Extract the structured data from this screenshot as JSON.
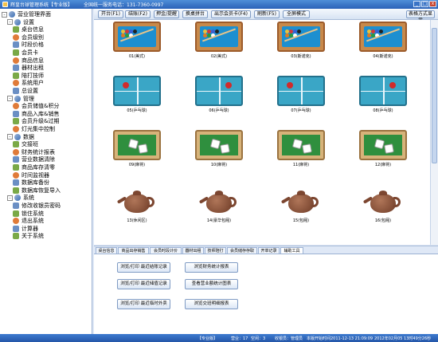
{
  "window": {
    "title": "辉皇台球管理系统【专业版】",
    "phone": "全国统一服务电话：131-7360-0997",
    "controls": [
      "_",
      "□",
      "x"
    ]
  },
  "tree": {
    "rows": [
      {
        "label": "营业管理界面",
        "level": 0,
        "exp": "-",
        "icon": "computer-icon"
      },
      {
        "label": "设置",
        "level": 1,
        "exp": "-",
        "icon": "settings-group-icon"
      },
      {
        "label": "桌台信息",
        "level": 2,
        "icon": "table-icon"
      },
      {
        "label": "会员级别",
        "level": 2,
        "icon": "member-level-icon"
      },
      {
        "label": "时段价格",
        "level": 2,
        "icon": "clock-price-icon"
      },
      {
        "label": "会员卡",
        "level": 2,
        "icon": "card-icon"
      },
      {
        "label": "商品信息",
        "level": 2,
        "icon": "goods-icon"
      },
      {
        "label": "器材出租",
        "level": 2,
        "icon": "equipment-icon"
      },
      {
        "label": "陪打技师",
        "level": 2,
        "icon": "coach-icon"
      },
      {
        "label": "系统用户",
        "level": 2,
        "icon": "user-icon"
      },
      {
        "label": "总设置",
        "level": 2,
        "icon": "gear-icon"
      },
      {
        "label": "管理",
        "level": 1,
        "exp": "-",
        "icon": "manage-group-icon"
      },
      {
        "label": "会员储值&积分",
        "level": 2,
        "icon": "points-icon"
      },
      {
        "label": "商品入库&销售",
        "level": 2,
        "icon": "stock-icon"
      },
      {
        "label": "会员升级&过期",
        "level": 2,
        "icon": "upgrade-icon"
      },
      {
        "label": "灯光集中控制",
        "level": 2,
        "icon": "light-icon"
      },
      {
        "label": "数据",
        "level": 1,
        "exp": "-",
        "icon": "data-group-icon"
      },
      {
        "label": "交接班",
        "level": 2,
        "icon": "shift-icon"
      },
      {
        "label": "财务统计报表",
        "level": 2,
        "icon": "finance-icon"
      },
      {
        "label": "营业数据清除",
        "level": 2,
        "icon": "clear-icon"
      },
      {
        "label": "商品库存清零",
        "level": 2,
        "icon": "reset-stock-icon"
      },
      {
        "label": "时间监视器",
        "level": 2,
        "icon": "timer-icon"
      },
      {
        "label": "数据库备份",
        "level": 2,
        "icon": "backup-icon"
      },
      {
        "label": "数据库恢复导入",
        "level": 2,
        "icon": "restore-icon"
      },
      {
        "label": "系统",
        "level": 1,
        "exp": "-",
        "icon": "system-group-icon"
      },
      {
        "label": "修改收银员密码",
        "level": 2,
        "icon": "password-icon"
      },
      {
        "label": "锁住系统",
        "level": 2,
        "icon": "lock-icon"
      },
      {
        "label": "退出系统",
        "level": 2,
        "icon": "exit-icon"
      },
      {
        "label": "计算器",
        "level": 2,
        "icon": "calculator-icon"
      },
      {
        "label": "关于系统",
        "level": 2,
        "icon": "about-icon"
      }
    ]
  },
  "toolbar": {
    "buttons": [
      {
        "label": "开台(F1)",
        "name": "open-table-button"
      },
      {
        "label": "结账(F2)",
        "name": "checkout-button"
      },
      {
        "label": "押金/提醒",
        "name": "deposit-button"
      },
      {
        "label": "换桌拼台",
        "name": "swap-table-button"
      },
      {
        "label": "出示会员卡(F4)",
        "name": "member-card-button"
      },
      {
        "label": "刷新(F5)",
        "name": "refresh-button"
      },
      {
        "label": "全屏模式",
        "name": "fullscreen-button"
      }
    ],
    "view_mode_label": "表格方式显示"
  },
  "tiles": [
    {
      "caption": "01(美式)",
      "kind": "billiard"
    },
    {
      "caption": "02(美式)",
      "kind": "billiard"
    },
    {
      "caption": "03(斯诺克)",
      "kind": "billiard"
    },
    {
      "caption": "04(斯诺克)",
      "kind": "billiard"
    },
    {
      "caption": "05(乒乓球)",
      "kind": "pingpong"
    },
    {
      "caption": "06(乒乓球)",
      "kind": "pingpong"
    },
    {
      "caption": "07(乒乓球)",
      "kind": "pingpong"
    },
    {
      "caption": "08(乒乓球)",
      "kind": "pingpong"
    },
    {
      "caption": "09(麻将)",
      "kind": "mahjong"
    },
    {
      "caption": "10(麻将)",
      "kind": "mahjong"
    },
    {
      "caption": "11(麻将)",
      "kind": "mahjong"
    },
    {
      "caption": "12(麻将)",
      "kind": "mahjong"
    },
    {
      "caption": "13(休闲区)",
      "kind": "teapot"
    },
    {
      "caption": "14(豪华包厢)",
      "kind": "teapot"
    },
    {
      "caption": "15(包厢)",
      "kind": "teapot"
    },
    {
      "caption": "16(包厢)",
      "kind": "teapot"
    }
  ],
  "tabs": [
    {
      "label": "桌台信息",
      "active": false
    },
    {
      "label": "商品出存销售",
      "active": false
    },
    {
      "label": "会员时段计价",
      "active": false
    },
    {
      "label": "器材出租",
      "active": false
    },
    {
      "label": "技师陪打",
      "active": false
    },
    {
      "label": "会员储存存取",
      "active": false
    },
    {
      "label": "开单记录",
      "active": false
    },
    {
      "label": "辅助工具",
      "active": true
    }
  ],
  "tools": [
    {
      "label": "浏览/打印  最近结账记录"
    },
    {
      "label": "浏览财务统计报表"
    },
    {
      "label": "浏览/打印  最近储值记录"
    },
    {
      "label": "查看营业额统计图表"
    },
    {
      "label": "浏览/打印  最近临时外卖"
    },
    {
      "label": "浏览交班明细报表"
    }
  ],
  "status": {
    "edition": "【专业版】",
    "business": "营业：17",
    "idle": "空闲：3",
    "cashier": "收银员：管理员",
    "opened": "本版开始时间2011-12-13 21:09:09",
    "clock": "2012年02月05  13时49分26秒"
  },
  "colors": {
    "titlebar": "#2a62b8",
    "tree_bg": "#ffffff",
    "panel_bg": "#dfe8f6",
    "statusbar": "#2456a8"
  }
}
